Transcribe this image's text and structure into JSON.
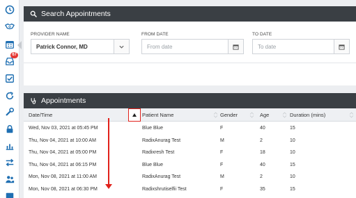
{
  "search_panel": {
    "title": "Search Appointments",
    "provider_label": "PROVIDER NAME",
    "provider_value": "Patrick Connor, MD",
    "from_label": "FROM DATE",
    "from_placeholder": "From date",
    "to_label": "TO DATE",
    "to_placeholder": "To date"
  },
  "appointments_panel": {
    "title": "Appointments",
    "columns": [
      "Date/Time",
      "Patient Name",
      "Gender",
      "Age",
      "Duration (mins)"
    ],
    "rows": [
      {
        "datetime": "Wed, Nov 03, 2021 at 05:45 PM",
        "patient": "Blue Blue",
        "gender": "F",
        "age": "40",
        "duration": "15"
      },
      {
        "datetime": "Thu, Nov 04, 2021 at 10:00 AM",
        "patient": "RadixAnurag Test",
        "gender": "M",
        "age": "2",
        "duration": "10"
      },
      {
        "datetime": "Thu, Nov 04, 2021 at 05:00 PM",
        "patient": "Radixresh Test",
        "gender": "F",
        "age": "18",
        "duration": "10"
      },
      {
        "datetime": "Thu, Nov 04, 2021 at 06:15 PM",
        "patient": "Blue Blue",
        "gender": "F",
        "age": "40",
        "duration": "15"
      },
      {
        "datetime": "Mon, Nov 08, 2021 at 11:00 AM",
        "patient": "RadixAnurag Test",
        "gender": "M",
        "age": "2",
        "duration": "10"
      },
      {
        "datetime": "Mon, Nov 08, 2021 at 06:30 PM",
        "patient": "Radixshrutiselfii Test",
        "gender": "F",
        "age": "35",
        "duration": "15"
      }
    ]
  },
  "sidebar": {
    "badge_count": "67",
    "icons": [
      "clock-icon",
      "handshake-icon",
      "calendar-icon",
      "inbox-icon",
      "checkbox-icon",
      "refresh-icon",
      "wrench-icon",
      "lock-icon",
      "bar-chart-icon",
      "transfer-icon",
      "users-icon"
    ]
  },
  "colors": {
    "header_bg": "#3a3f44",
    "sidebar_icon": "#1f6fb2",
    "highlight": "#e1211b",
    "badge": "#e53935"
  }
}
